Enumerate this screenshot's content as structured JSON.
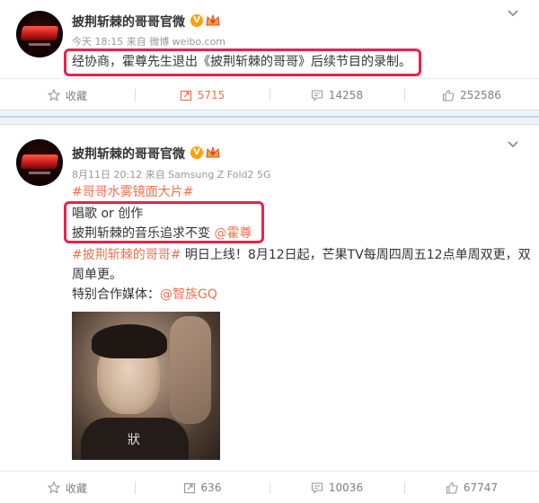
{
  "post1": {
    "author": "披荆斩棘的哥哥官微",
    "meta": "今天 18:15 来自 微博 weibo.com",
    "text": "经协商，霍尊先生退出《披荆斩棘的哥哥》后续节目的录制。",
    "actions": {
      "favorite": "收藏",
      "repost": "5715",
      "comment": "14258",
      "like": "252586"
    }
  },
  "post2": {
    "author": "披荆斩棘的哥哥官微",
    "meta": "8月11日 20:12 来自 Samsung Z Fold2 5G",
    "hashtag1": "#哥哥水雾镜面大片#",
    "line1": "唱歌 or 创作",
    "line2_text": "披荆斩棘的音乐追求不变 ",
    "line2_mention": "@霍尊",
    "hashtag2": "#披荆斩棘的哥哥#",
    "line3_rest": " 明日上线！8月12日起，芒果TV每周四周五12点单周双更，双",
    "line4": "周单更。",
    "line5_text": "特别合作媒体：",
    "line5_mention": "@智族GQ",
    "photo_mark": "狀",
    "actions": {
      "favorite": "收藏",
      "repost": "636",
      "comment": "10036",
      "like": "67747"
    }
  },
  "colors": {
    "highlight": "#e8234a",
    "link": "#eb7350",
    "verified": "#ffa00a"
  },
  "icons": [
    "star-icon",
    "repost-icon",
    "comment-icon",
    "thumbs-up-icon",
    "chevron-down-icon",
    "verified-badge-icon",
    "crown-icon"
  ]
}
